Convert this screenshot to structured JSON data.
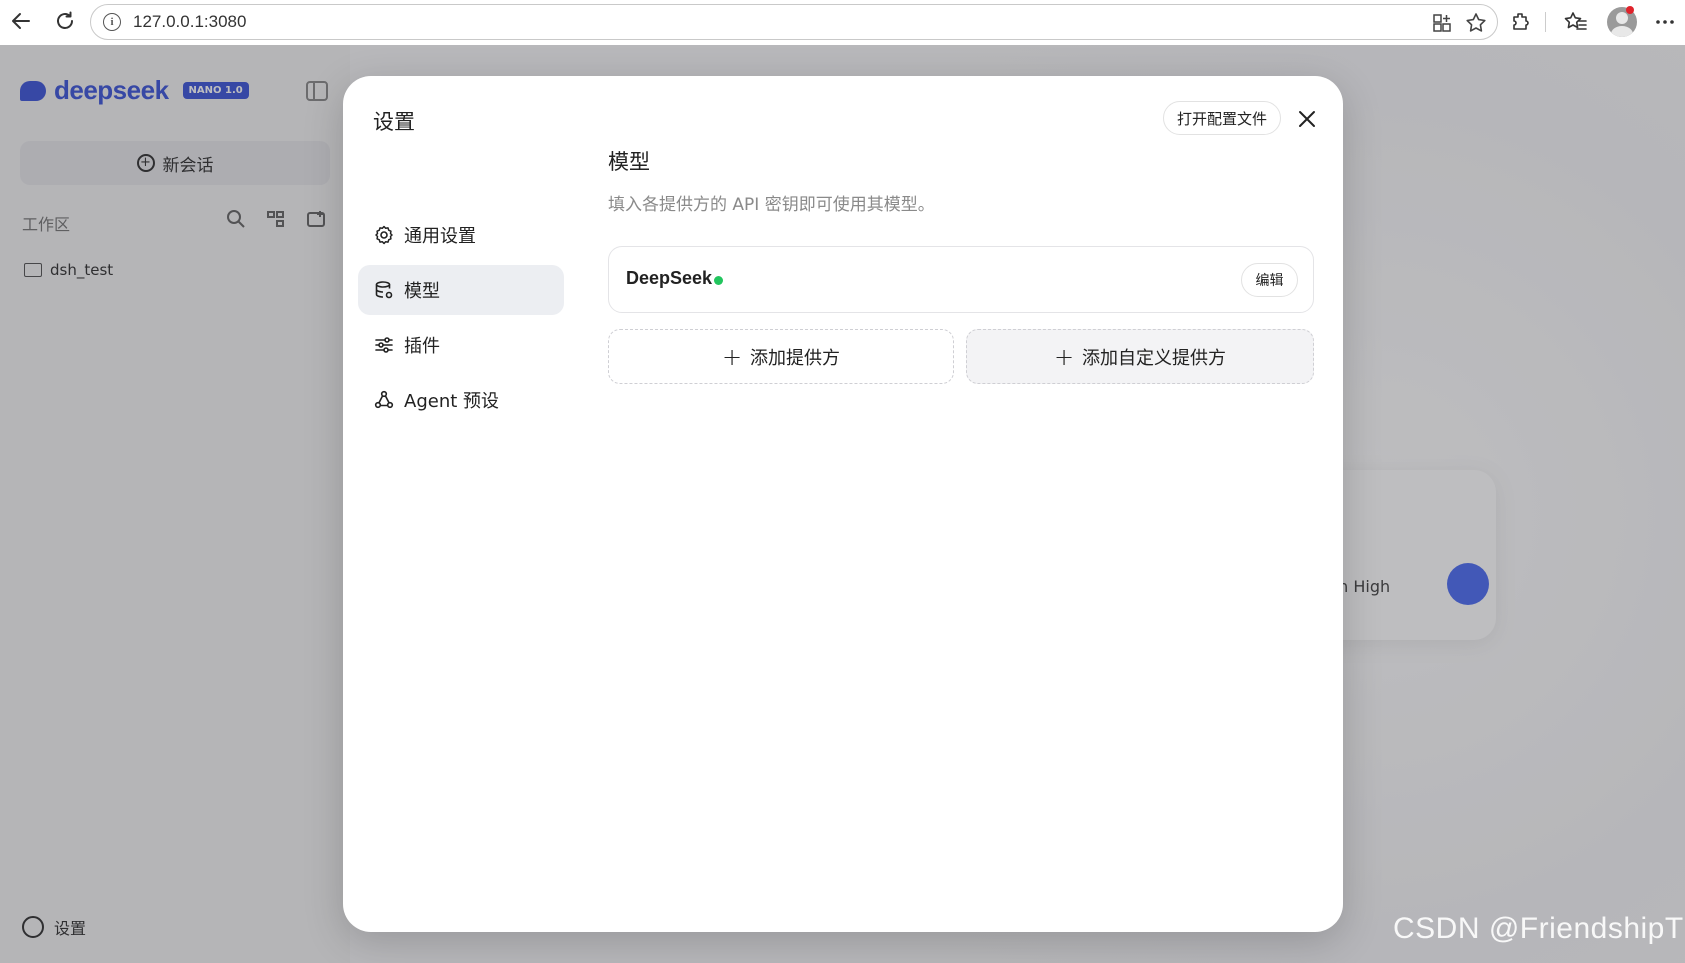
{
  "browser": {
    "url": "127.0.0.1:3080"
  },
  "sidebar": {
    "brand_name": "deepseek",
    "brand_badge": "NANO 1.0",
    "new_chat_label": "新会话",
    "workspace_label": "工作区",
    "workspace_items": [
      "dsh_test"
    ],
    "settings_label": "设置"
  },
  "composer": {
    "model_hint": "ash  High"
  },
  "modal": {
    "title": "设置",
    "open_config_label": "打开配置文件",
    "menu": [
      {
        "label": "通用设置",
        "icon": "gear-icon"
      },
      {
        "label": "模型",
        "icon": "database-icon",
        "active": true
      },
      {
        "label": "插件",
        "icon": "sliders-icon"
      },
      {
        "label": "Agent 预设",
        "icon": "agent-icon"
      }
    ],
    "section_title": "模型",
    "section_desc": "填入各提供方的 API 密钥即可使用其模型。",
    "providers": [
      {
        "name": "DeepSeek",
        "status_color": "#22c55e",
        "edit_label": "编辑"
      }
    ],
    "add_provider_label": "添加提供方",
    "add_custom_provider_label": "添加自定义提供方"
  },
  "watermark": "CSDN @FriendshipT",
  "colors": {
    "brand": "#3e56d8",
    "status_ok": "#22c55e",
    "active_menu_bg": "#eceef2"
  }
}
